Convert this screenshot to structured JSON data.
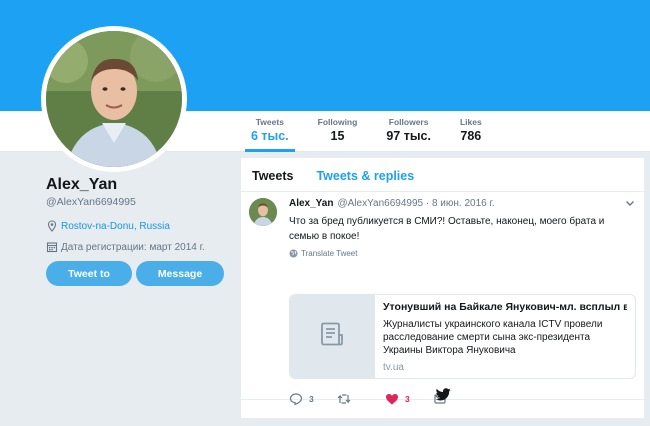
{
  "profile": {
    "name": "Alex_Yan",
    "handle": "@AlexYan6694995",
    "location": "Rostov-na-Donu, Russia",
    "joined": "Дата регистрации: март 2014 г.",
    "tweet_button": "Tweet to",
    "message_button": "Message"
  },
  "stats": [
    {
      "label": "Tweets",
      "value": "6 тыс."
    },
    {
      "label": "Following",
      "value": "15"
    },
    {
      "label": "Followers",
      "value": "97 тыс."
    },
    {
      "label": "Likes",
      "value": "786"
    }
  ],
  "timeline": {
    "tabs": [
      "Tweets",
      "Tweets & replies"
    ],
    "tweet": {
      "name": "Alex_Yan",
      "handle_date": "@AlexYan6694995 · 8 июн. 2016 г.",
      "text": "Что за бред публикуется в СМИ?! Оставьте, наконец, моего брата и семью в покое!",
      "translate": "Translate Tweet",
      "card": {
        "title": "Утонувший на Байкале Янукович-мл. всплыл в ...",
        "description": "Журналисты украинского канала ICTV провели расследование смерти сына экс-президента Украины Виктора Януковича",
        "domain": "tv.ua"
      },
      "replies": "3",
      "retweets": "",
      "likes": "3"
    }
  },
  "colors": {
    "brand": "#1da1f2",
    "like": "#e0245e",
    "background": "#e6ecf0"
  },
  "icons": [
    "location-pin-icon",
    "calendar-icon",
    "globe-icon",
    "chevron-down-icon",
    "document-icon",
    "reply-icon",
    "retweet-icon",
    "heart-icon",
    "message-icon",
    "twitter-bird-icon"
  ]
}
